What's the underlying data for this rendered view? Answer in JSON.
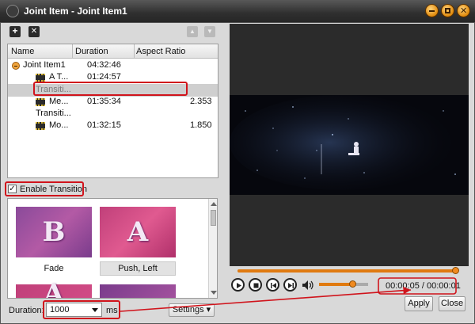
{
  "window": {
    "title": "Joint Item - Joint Item1",
    "controls": [
      "minimize-icon",
      "maximize-icon",
      "close-icon"
    ]
  },
  "toolbar": {
    "add_icon": "+",
    "remove_icon": "✕",
    "up_icon": "▲",
    "down_icon": "▼"
  },
  "list": {
    "columns": [
      "Name",
      "Duration",
      "Aspect Ratio"
    ],
    "rows": [
      {
        "name": "Joint Item1",
        "duration": "04:32:46",
        "aspect": "",
        "kind": "group"
      },
      {
        "name": "A T...",
        "duration": "01:24:57",
        "aspect": "",
        "kind": "video"
      },
      {
        "name": "Transiti...",
        "duration": "",
        "aspect": "",
        "kind": "transition",
        "selected": true
      },
      {
        "name": "Me...",
        "duration": "01:35:34",
        "aspect": "2.353",
        "kind": "video"
      },
      {
        "name": "Transiti...",
        "duration": "",
        "aspect": "",
        "kind": "transition"
      },
      {
        "name": "Mo...",
        "duration": "01:32:15",
        "aspect": "1.850",
        "kind": "video"
      }
    ]
  },
  "enable_transition": {
    "label": "Enable Transition",
    "checked": true,
    "mark": "✓"
  },
  "transitions": [
    {
      "label": "Fade",
      "letter": "B",
      "selected": false
    },
    {
      "label": "Push, Left",
      "letter": "A",
      "selected": true
    },
    {
      "label": "",
      "letter": "A",
      "selected": false
    },
    {
      "label": "",
      "letter": "",
      "selected": false
    }
  ],
  "duration": {
    "label": "Duration:",
    "value": "1000",
    "unit": "ms"
  },
  "settings": {
    "label": "Settings"
  },
  "player": {
    "progress": 1.0,
    "volume": 0.68,
    "time": "00:00:05 / 00:00:01"
  },
  "buttons": {
    "apply": "Apply",
    "close": "Close"
  },
  "colors": {
    "accent": "#e07a10",
    "highlight": "#d0141c"
  }
}
